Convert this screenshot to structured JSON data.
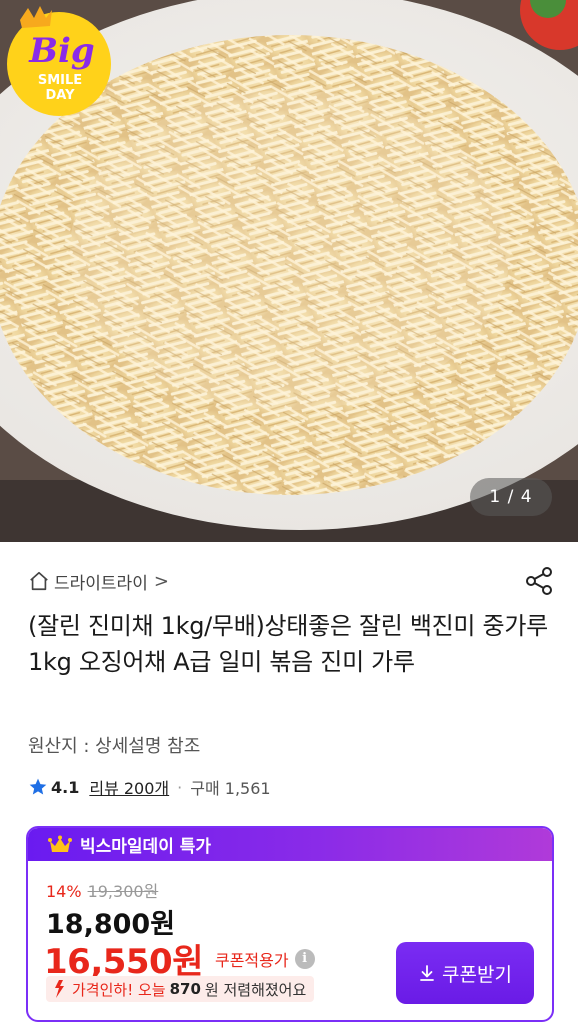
{
  "gallery": {
    "counter": "1 / 4",
    "badge": {
      "line1": "Big",
      "line2": "SMILE",
      "line3": "DAY"
    }
  },
  "breadcrumb": {
    "store": "드라이트라이",
    "chevron": ">"
  },
  "product": {
    "title": "(잘린 진미채 1kg/무배)상태좋은 잘린 백진미 중가루 1kg 오징어채 A급 일미 볶음 진미 가루",
    "origin": "원산지 : 상세설명 참조"
  },
  "rating": {
    "score": "4.1",
    "review": "리뷰 200개",
    "separator": "·",
    "purchases": "구매 1,561"
  },
  "price_card": {
    "header": "빅스마일데이 특가",
    "discount_pct": "14%",
    "original_price": "19,300원",
    "sale_price": "18,800원",
    "coupon_price": "16,550원",
    "coupon_label": "쿠폰적용가",
    "info_icon": "i",
    "drop_prefix": "가격인하! 오늘 ",
    "drop_amount": "870",
    "drop_suffix": "원 저렴해졌어요",
    "coupon_button": "쿠폰받기"
  },
  "colors": {
    "brand_purple": "#7b2ff7",
    "price_red": "#e8271b",
    "star_blue": "#1f6fe5"
  },
  "icons": [
    "home-icon",
    "share-icon",
    "star-icon",
    "crown-icon",
    "info-icon",
    "price-drop-arrow-icon",
    "download-icon"
  ]
}
